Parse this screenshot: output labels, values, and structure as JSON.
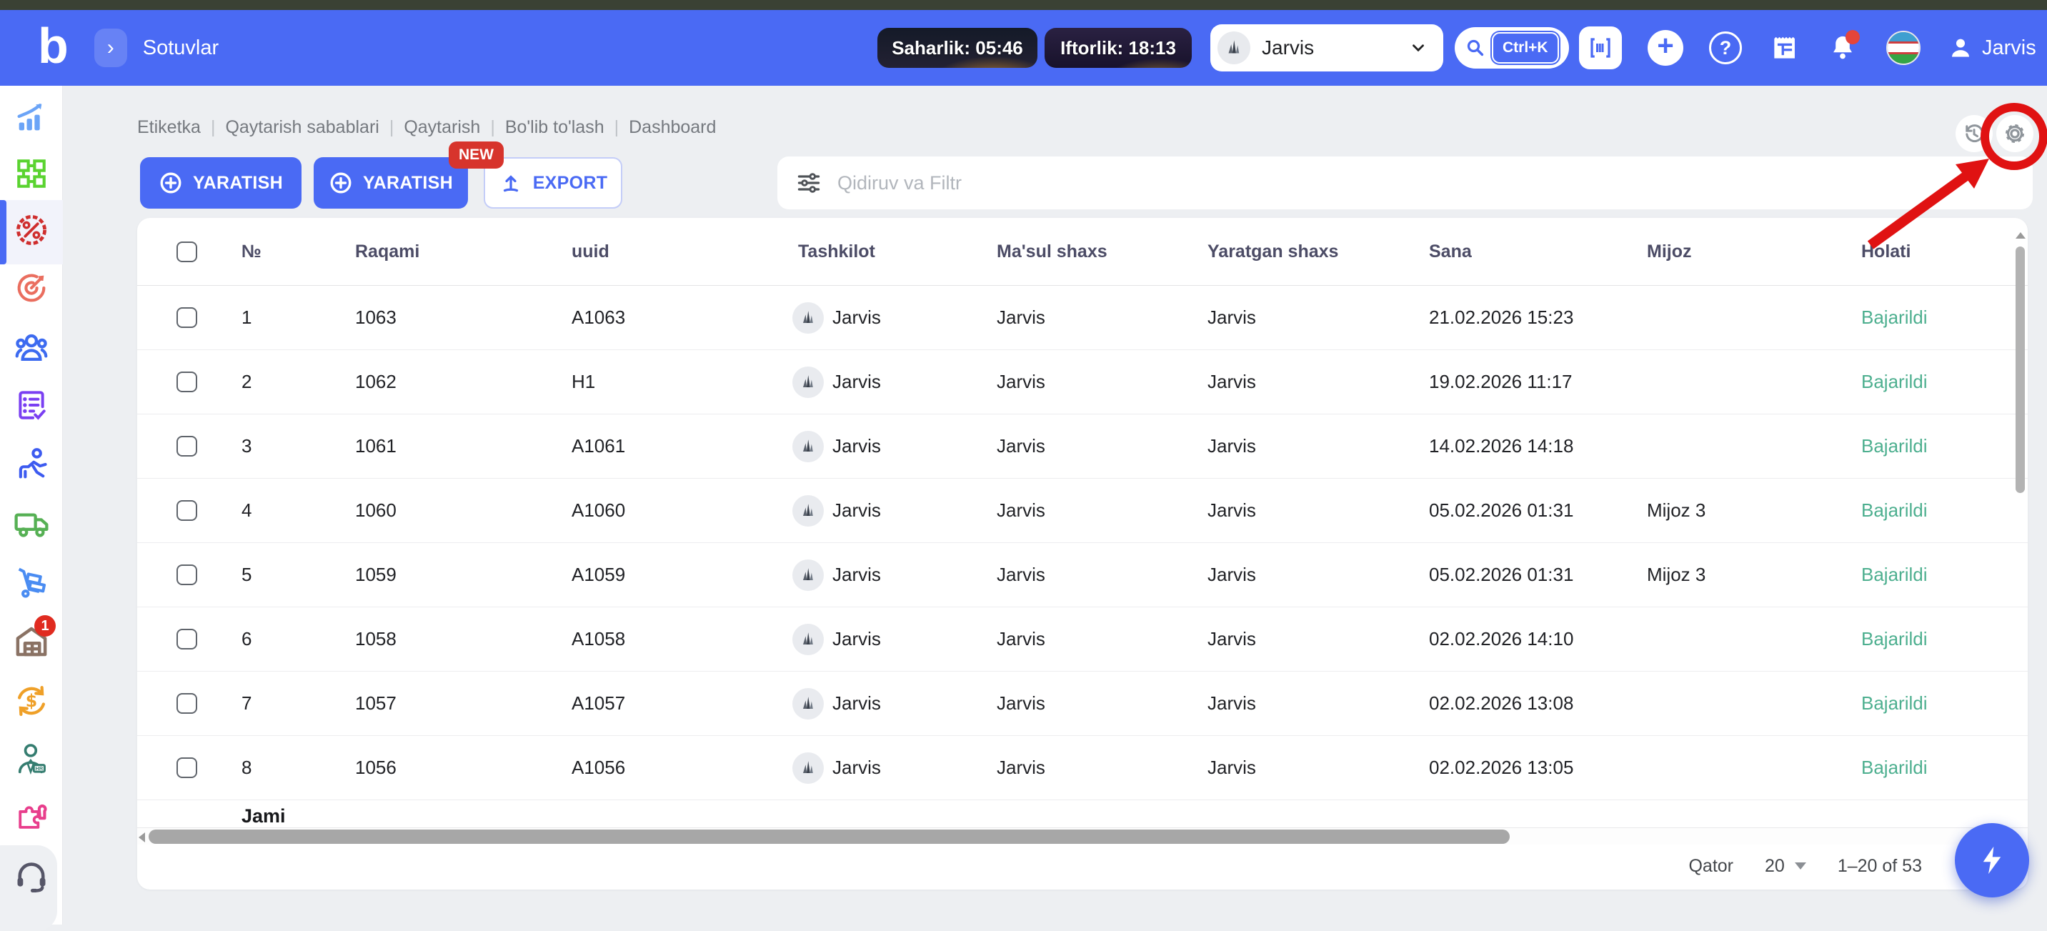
{
  "topbar": {
    "logo": "b",
    "page_title": "Sotuvlar",
    "saharlik_badge": "Saharlik: 05:46",
    "iftorlik_badge": "Iftorlik: 18:13",
    "org_selector": "Jarvis",
    "search_shortcut": "Ctrl+K",
    "user_name": "Jarvis"
  },
  "sidebar": {
    "items": [
      "statistics-icon",
      "modules-icon",
      "sales-icon",
      "marketing-target-icon",
      "clients-icon",
      "orders-checklist-icon",
      "courier-icon",
      "delivery-truck-icon",
      "procurement-cart-icon",
      "warehouse-icon",
      "finance-exchange-icon",
      "hr-icon",
      "integrations-puzzle-icon",
      "support-headset-icon"
    ],
    "active_item": "sales-icon",
    "warehouse_badge": "1"
  },
  "toolbar": {
    "breadcrumb": [
      "Etiketka",
      "Qaytarish sabablari",
      "Qaytarish",
      "Bo'lib to'lash",
      "Dashboard"
    ],
    "create_button": "YARATISH",
    "create_button_2": "YARATISH",
    "new_badge": "NEW",
    "export_button": "EXPORT",
    "filter_placeholder": "Qidiruv va Filtr"
  },
  "table": {
    "columns": [
      "№",
      "Raqami",
      "uuid",
      "Tashkilot",
      "Ma'sul shaxs",
      "Yaratgan shaxs",
      "Sana",
      "Mijoz",
      "Holati"
    ],
    "rows": [
      {
        "n": "1",
        "raqami": "1063",
        "uuid": "A1063",
        "tashkilot": "Jarvis",
        "masul": "Jarvis",
        "yaratgan": "Jarvis",
        "sana": "21.02.2026 15:23",
        "mijoz": "",
        "holati": "Bajarildi"
      },
      {
        "n": "2",
        "raqami": "1062",
        "uuid": "H1",
        "tashkilot": "Jarvis",
        "masul": "Jarvis",
        "yaratgan": "Jarvis",
        "sana": "19.02.2026 11:17",
        "mijoz": "",
        "holati": "Bajarildi"
      },
      {
        "n": "3",
        "raqami": "1061",
        "uuid": "A1061",
        "tashkilot": "Jarvis",
        "masul": "Jarvis",
        "yaratgan": "Jarvis",
        "sana": "14.02.2026 14:18",
        "mijoz": "",
        "holati": "Bajarildi"
      },
      {
        "n": "4",
        "raqami": "1060",
        "uuid": "A1060",
        "tashkilot": "Jarvis",
        "masul": "Jarvis",
        "yaratgan": "Jarvis",
        "sana": "05.02.2026 01:31",
        "mijoz": "Mijoz 3",
        "holati": "Bajarildi"
      },
      {
        "n": "5",
        "raqami": "1059",
        "uuid": "A1059",
        "tashkilot": "Jarvis",
        "masul": "Jarvis",
        "yaratgan": "Jarvis",
        "sana": "05.02.2026 01:31",
        "mijoz": "Mijoz 3",
        "holati": "Bajarildi"
      },
      {
        "n": "6",
        "raqami": "1058",
        "uuid": "A1058",
        "tashkilot": "Jarvis",
        "masul": "Jarvis",
        "yaratgan": "Jarvis",
        "sana": "02.02.2026 14:10",
        "mijoz": "",
        "holati": "Bajarildi"
      },
      {
        "n": "7",
        "raqami": "1057",
        "uuid": "A1057",
        "tashkilot": "Jarvis",
        "masul": "Jarvis",
        "yaratgan": "Jarvis",
        "sana": "02.02.2026 13:08",
        "mijoz": "",
        "holati": "Bajarildi"
      },
      {
        "n": "8",
        "raqami": "1056",
        "uuid": "A1056",
        "tashkilot": "Jarvis",
        "masul": "Jarvis",
        "yaratgan": "Jarvis",
        "sana": "02.02.2026 13:05",
        "mijoz": "",
        "holati": "Bajarildi"
      }
    ],
    "summary_label": "Jami"
  },
  "pagination": {
    "rows_per_page_label": "Qator",
    "rows_per_page": "20",
    "range": "1–20 of 53"
  },
  "colors": {
    "accent": "#4a6af4",
    "status_done": "#4daf8f",
    "new_badge": "#d7342c",
    "annotation_red": "#e01212"
  }
}
